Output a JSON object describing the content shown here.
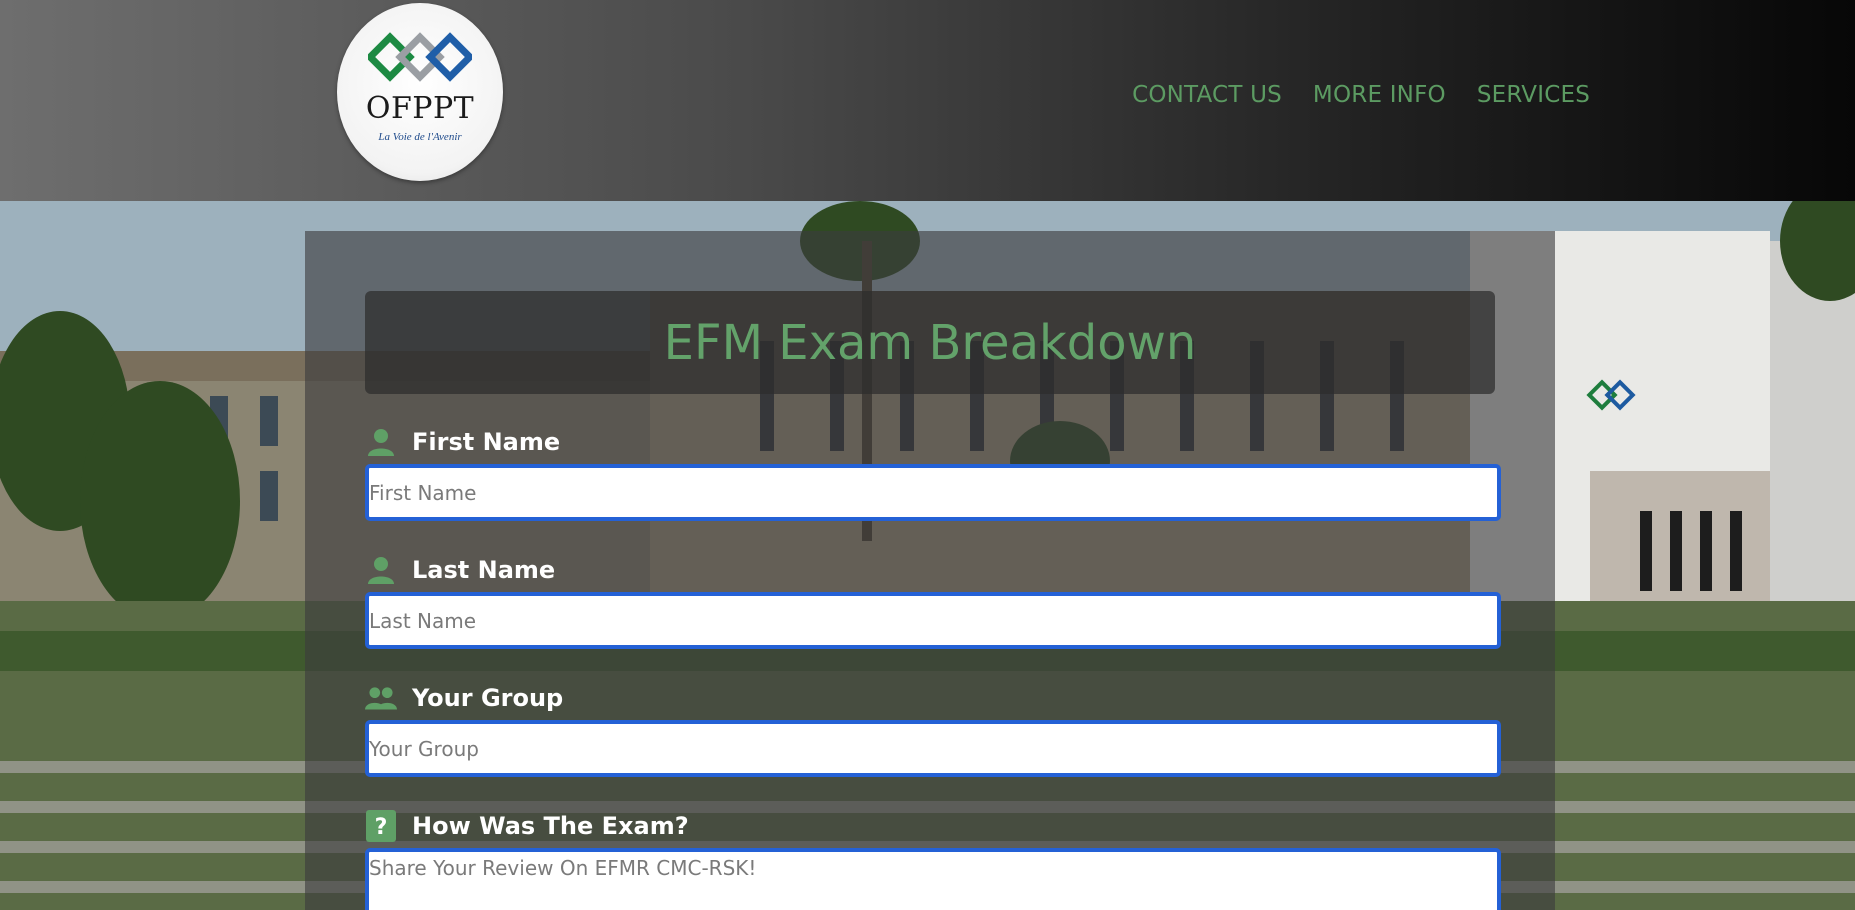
{
  "header": {
    "logo": {
      "name": "OFPPT",
      "tagline": "La Voie de l'Avenir"
    },
    "nav": [
      {
        "label": "CONTACT US"
      },
      {
        "label": "MORE INFO"
      },
      {
        "label": "SERVICES"
      }
    ]
  },
  "form": {
    "title": "EFM Exam Breakdown",
    "fields": {
      "first_name": {
        "label": "First Name",
        "placeholder": "First Name",
        "value": "",
        "icon": "user-icon"
      },
      "last_name": {
        "label": "Last Name",
        "placeholder": "Last Name",
        "value": "",
        "icon": "user-icon"
      },
      "group": {
        "label": "Your Group",
        "placeholder": "Your Group",
        "value": "",
        "icon": "users-icon"
      },
      "review": {
        "label": "How Was The Exam?",
        "placeholder": "Share Your Review On EFMR CMC-RSK!",
        "value": "",
        "icon": "question-icon"
      }
    }
  },
  "colors": {
    "accent_green": "#63a26a",
    "input_border": "#2461d6",
    "header_dark": "#070707"
  }
}
